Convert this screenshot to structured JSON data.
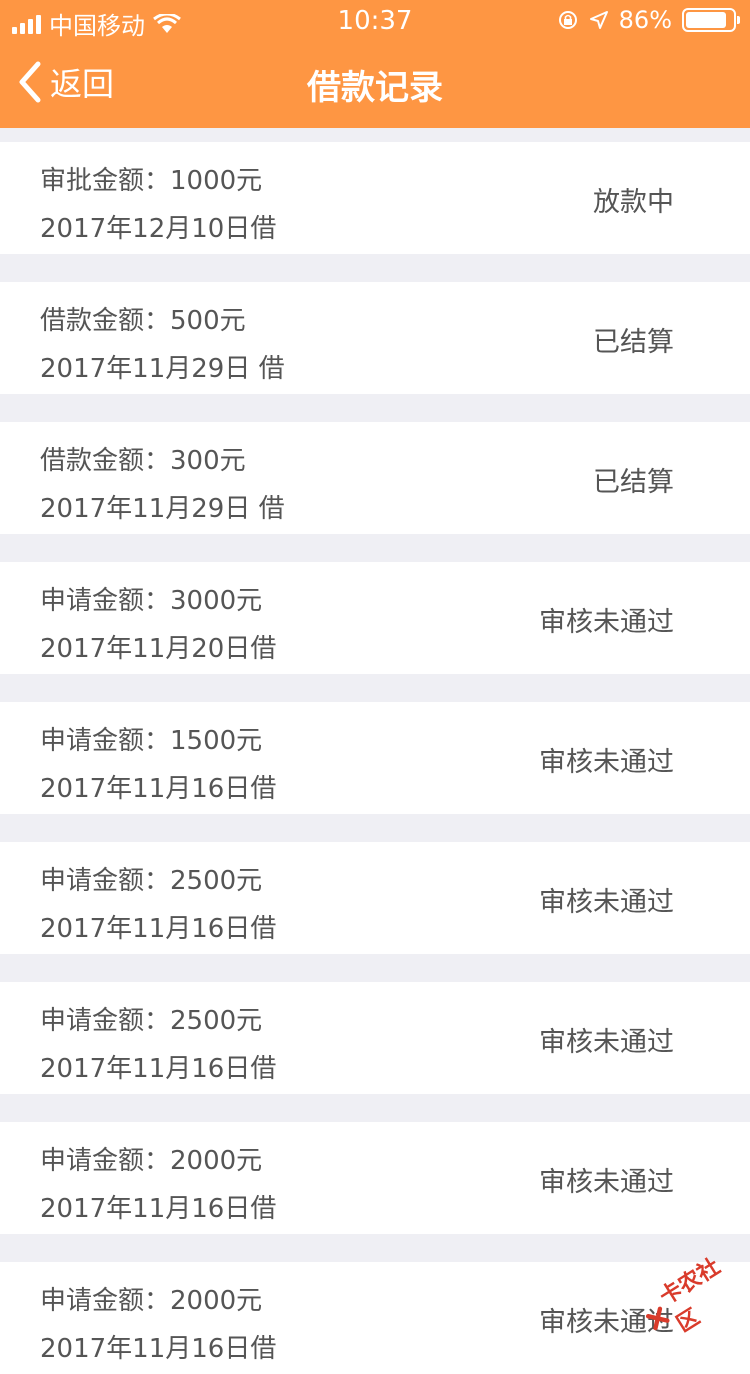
{
  "status_bar": {
    "carrier": "中国移动",
    "time": "10:37",
    "battery_percent": "86%",
    "battery_level": 0.86
  },
  "nav": {
    "back_label": "返回",
    "title": "借款记录"
  },
  "records": [
    {
      "amount": "审批金额：1000元",
      "date": "2017年12月10日借",
      "status": "放款中"
    },
    {
      "amount": "借款金额：500元",
      "date": "2017年11月29日 借",
      "status": "已结算"
    },
    {
      "amount": "借款金额：300元",
      "date": "2017年11月29日 借",
      "status": "已结算"
    },
    {
      "amount": "申请金额：3000元",
      "date": "2017年11月20日借",
      "status": "审核未通过"
    },
    {
      "amount": "申请金额：1500元",
      "date": "2017年11月16日借",
      "status": "审核未通过"
    },
    {
      "amount": "申请金额：2500元",
      "date": "2017年11月16日借",
      "status": "审核未通过"
    },
    {
      "amount": "申请金额：2500元",
      "date": "2017年11月16日借",
      "status": "审核未通过"
    },
    {
      "amount": "申请金额：2000元",
      "date": "2017年11月16日借",
      "status": "审核未通过"
    },
    {
      "amount": "申请金额：2000元",
      "date": "2017年11月16日借",
      "status": "审核未通过"
    }
  ],
  "watermark": {
    "text": "卡农社区"
  },
  "colors": {
    "header": "#fe9643",
    "background": "#efeff4",
    "row_text": "#555555"
  }
}
